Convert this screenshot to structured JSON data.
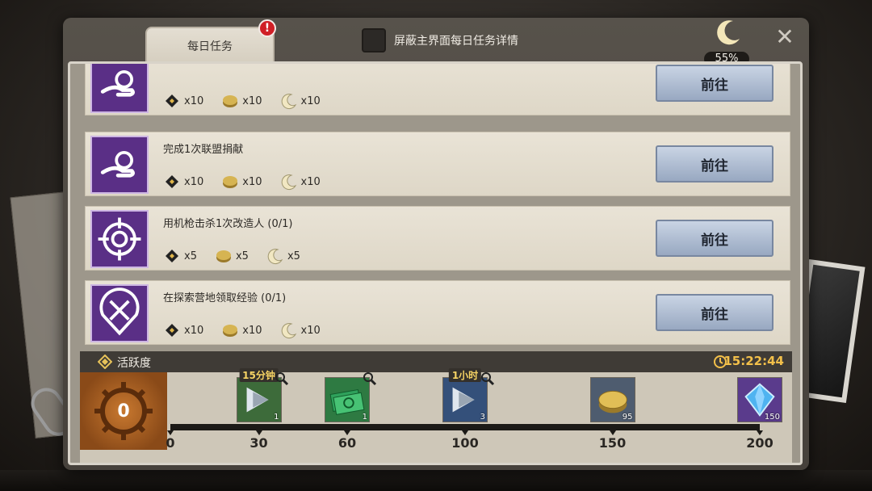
{
  "tab": {
    "label": "每日任务",
    "alert": "!"
  },
  "hide_toggle": {
    "label": "屏蔽主界面每日任务详情",
    "checked": false
  },
  "moon_progress": {
    "percent": "55%"
  },
  "close_label": "✕",
  "tasks": [
    {
      "title": "",
      "icon": "donate-coin-icon",
      "rewards": [
        {
          "icon": "ticket-icon",
          "qty": "x10"
        },
        {
          "icon": "coin-icon",
          "qty": "x10"
        },
        {
          "icon": "moon-icon",
          "qty": "x10"
        }
      ],
      "button": "前往"
    },
    {
      "title": "完成1次联盟捐献",
      "icon": "donate-coin-icon",
      "rewards": [
        {
          "icon": "ticket-icon",
          "qty": "x10"
        },
        {
          "icon": "coin-icon",
          "qty": "x10"
        },
        {
          "icon": "moon-icon",
          "qty": "x10"
        }
      ],
      "button": "前往"
    },
    {
      "title": "用机枪击杀1次改造人 (0/1)",
      "icon": "crosshair-icon",
      "rewards": [
        {
          "icon": "ticket-icon",
          "qty": "x5"
        },
        {
          "icon": "coin-icon",
          "qty": "x5"
        },
        {
          "icon": "moon-icon",
          "qty": "x5"
        }
      ],
      "button": "前往"
    },
    {
      "title": "在探索营地领取经验 (0/1)",
      "icon": "map-pin-cross-icon",
      "rewards": [
        {
          "icon": "ticket-icon",
          "qty": "x10"
        },
        {
          "icon": "coin-icon",
          "qty": "x10"
        },
        {
          "icon": "moon-icon",
          "qty": "x10"
        }
      ],
      "button": "前往"
    }
  ],
  "activity": {
    "label": "活跃度",
    "timer": "15:22:44",
    "points": "0",
    "max": 200,
    "current": 0,
    "ticks": [
      "0",
      "30",
      "60",
      "100",
      "150",
      "200"
    ],
    "tick_values": [
      0,
      30,
      60,
      100,
      150,
      200
    ],
    "chests": [
      {
        "at": 30,
        "top": "15分钟",
        "count": "1",
        "icon": "speedup-scroll-icon",
        "bg": "#3d6b3a"
      },
      {
        "at": 60,
        "top": "",
        "count": "1",
        "icon": "cash-stack-icon",
        "bg": "#2e7a42"
      },
      {
        "at": 100,
        "top": "1小时",
        "count": "3",
        "icon": "speedup-scroll-icon",
        "bg": "#34507a"
      },
      {
        "at": 150,
        "top": "",
        "count": "95",
        "icon": "gold-coins-icon",
        "bg": "#4e5c6f"
      },
      {
        "at": 200,
        "top": "",
        "count": "150",
        "icon": "blue-gem-icon",
        "bg": "#5a3b8c"
      }
    ]
  }
}
